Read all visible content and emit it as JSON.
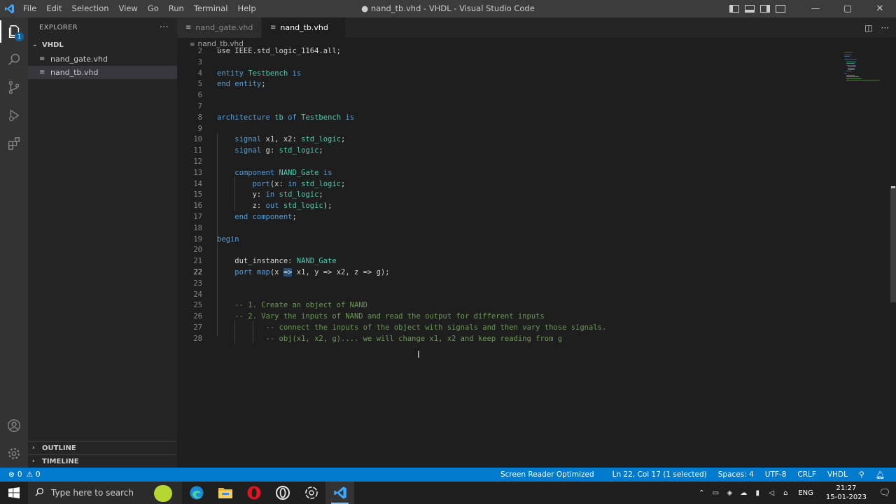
{
  "window": {
    "title": "● nand_tb.vhd - VHDL - Visual Studio Code",
    "menu": [
      "File",
      "Edit",
      "Selection",
      "View",
      "Go",
      "Run",
      "Terminal",
      "Help"
    ]
  },
  "activity_bar": {
    "explorer_badge": "1",
    "items": [
      "explorer-icon",
      "search-icon",
      "source-control-icon",
      "run-debug-icon",
      "extensions-icon"
    ],
    "bottom": [
      "account-icon",
      "settings-gear-icon"
    ]
  },
  "sidebar": {
    "header": "EXPLORER",
    "more": "···",
    "folder": "VHDL",
    "files": [
      "nand_gate.vhd",
      "nand_tb.vhd"
    ],
    "outline": "OUTLINE",
    "timeline": "TIMELINE"
  },
  "tabs": [
    {
      "label": "nand_gate.vhd",
      "active": false,
      "modified": false
    },
    {
      "label": "nand_tb.vhd",
      "active": true,
      "modified": true
    }
  ],
  "breadcrumb": "nand_tb.vhd",
  "editor": {
    "current_line": 22,
    "lines": [
      {
        "n": "2",
        "tokens": [
          {
            "t": "use IEEE.std_logic_1164.all;",
            "c": ""
          }
        ]
      },
      {
        "n": "3",
        "tokens": []
      },
      {
        "n": "4",
        "tokens": [
          {
            "t": "entity ",
            "c": "kw"
          },
          {
            "t": "Testbench",
            "c": "ty"
          },
          {
            "t": " is",
            "c": "kw"
          }
        ]
      },
      {
        "n": "5",
        "tokens": [
          {
            "t": "end entity",
            "c": "kw"
          },
          {
            "t": ";",
            "c": ""
          }
        ]
      },
      {
        "n": "6",
        "tokens": []
      },
      {
        "n": "7",
        "tokens": []
      },
      {
        "n": "8",
        "tokens": [
          {
            "t": "architecture ",
            "c": "kw"
          },
          {
            "t": "tb",
            "c": "ty"
          },
          {
            "t": " of ",
            "c": "kw"
          },
          {
            "t": "Testbench",
            "c": "ty"
          },
          {
            "t": " is",
            "c": "kw"
          }
        ]
      },
      {
        "n": "9",
        "tokens": []
      },
      {
        "n": "10",
        "tokens": [
          {
            "t": "    signal ",
            "c": "kw"
          },
          {
            "t": "x1, x2: ",
            "c": ""
          },
          {
            "t": "std_logic",
            "c": "ty"
          },
          {
            "t": ";",
            "c": ""
          }
        ]
      },
      {
        "n": "11",
        "tokens": [
          {
            "t": "    signal ",
            "c": "kw"
          },
          {
            "t": "g: ",
            "c": ""
          },
          {
            "t": "std_logic",
            "c": "ty"
          },
          {
            "t": ";",
            "c": ""
          }
        ]
      },
      {
        "n": "12",
        "tokens": []
      },
      {
        "n": "13",
        "tokens": [
          {
            "t": "    component ",
            "c": "kw"
          },
          {
            "t": "NAND_Gate",
            "c": "ty"
          },
          {
            "t": " is",
            "c": "kw"
          }
        ]
      },
      {
        "n": "14",
        "tokens": [
          {
            "t": "        port",
            "c": "kw"
          },
          {
            "t": "(x: ",
            "c": ""
          },
          {
            "t": "in ",
            "c": "kw"
          },
          {
            "t": "std_logic",
            "c": "ty"
          },
          {
            "t": ";",
            "c": ""
          }
        ]
      },
      {
        "n": "15",
        "tokens": [
          {
            "t": "        y: ",
            "c": ""
          },
          {
            "t": "in ",
            "c": "kw"
          },
          {
            "t": "std_logic",
            "c": "ty"
          },
          {
            "t": ";",
            "c": ""
          }
        ]
      },
      {
        "n": "16",
        "tokens": [
          {
            "t": "        z: ",
            "c": ""
          },
          {
            "t": "out ",
            "c": "kw"
          },
          {
            "t": "std_logic",
            "c": "ty"
          },
          {
            "t": ");",
            "c": ""
          }
        ]
      },
      {
        "n": "17",
        "tokens": [
          {
            "t": "    end component",
            "c": "kw"
          },
          {
            "t": ";",
            "c": ""
          }
        ]
      },
      {
        "n": "18",
        "tokens": []
      },
      {
        "n": "19",
        "tokens": [
          {
            "t": "begin",
            "c": "kw"
          }
        ]
      },
      {
        "n": "20",
        "tokens": []
      },
      {
        "n": "21",
        "tokens": [
          {
            "t": "    dut_instance: ",
            "c": ""
          },
          {
            "t": "NAND_Gate",
            "c": "ty"
          }
        ]
      },
      {
        "n": "22",
        "tokens": [
          {
            "t": "    port map",
            "c": "kw"
          },
          {
            "t": "(x ",
            "c": ""
          },
          {
            "t": "=>",
            "c": "hl"
          },
          {
            "t": " x1, y => x2, z => g);",
            "c": ""
          }
        ]
      },
      {
        "n": "23",
        "tokens": []
      },
      {
        "n": "24",
        "tokens": []
      },
      {
        "n": "25",
        "tokens": [
          {
            "t": "    -- 1. Create an object of NAND",
            "c": "cm"
          }
        ]
      },
      {
        "n": "26",
        "tokens": [
          {
            "t": "    -- 2. Vary the inputs of NAND and read the output for different inputs",
            "c": "cm"
          }
        ]
      },
      {
        "n": "27",
        "tokens": [
          {
            "t": "           -- connect the inputs of the object with signals and then vary those signals.",
            "c": "cm"
          }
        ]
      },
      {
        "n": "28",
        "tokens": [
          {
            "t": "           -- obj(x1, x2, g).... we will change x1, x2 and keep reading from g",
            "c": "cm"
          }
        ]
      }
    ]
  },
  "status": {
    "errors": "0",
    "warnings": "0",
    "screen_reader": "Screen Reader Optimized",
    "position": "Ln 22, Col 17 (1 selected)",
    "spaces": "Spaces: 4",
    "encoding": "UTF-8",
    "eol": "CRLF",
    "language": "VHDL"
  },
  "taskbar": {
    "search_placeholder": "Type here to search",
    "apps": [
      "edge-icon",
      "file-explorer-icon",
      "opera-icon",
      "opera-gx-icon",
      "chatgpt-icon",
      "vscode-icon"
    ],
    "language": "ENG",
    "time": "21:27",
    "date": "15-01-2023"
  },
  "colors": {
    "accent": "#007acc",
    "keyword": "#569cd6",
    "type": "#4ec9b0",
    "comment": "#6a9955"
  }
}
